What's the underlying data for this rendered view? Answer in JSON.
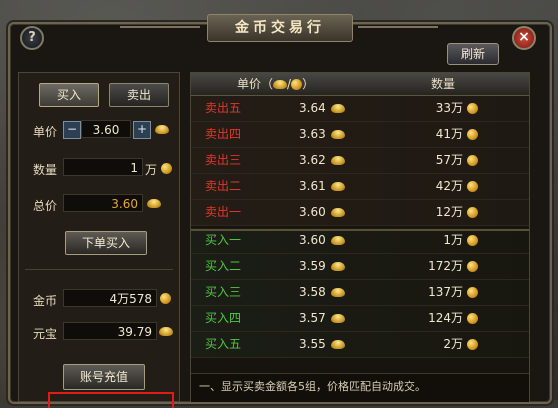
{
  "window": {
    "title": "金币交易行",
    "help_label": "?",
    "close_label": "×",
    "refresh_label": "刷新"
  },
  "tabs": [
    {
      "label": "买入",
      "active": true
    },
    {
      "label": "卖出",
      "active": false
    }
  ],
  "form": {
    "unit_price_label": "单价",
    "unit_price_value": "3.60",
    "minus_label": "−",
    "plus_label": "+",
    "quantity_label": "数量",
    "quantity_value": "1",
    "quantity_unit": "万",
    "total_label": "总价",
    "total_value": "3.60",
    "order_button": "下单买入"
  },
  "balance": {
    "gold_label": "金币",
    "gold_value": "4万578",
    "yuanbao_label": "元宝",
    "yuanbao_value": "39.79",
    "recharge_button": "账号充值"
  },
  "table": {
    "header_price": "单价（",
    "header_price_sep": "/",
    "header_price_end": "）",
    "header_qty": "数量",
    "sell_rows": [
      {
        "name": "卖出五",
        "price": "3.64",
        "qty": "33万"
      },
      {
        "name": "卖出四",
        "price": "3.63",
        "qty": "41万"
      },
      {
        "name": "卖出三",
        "price": "3.62",
        "qty": "57万"
      },
      {
        "name": "卖出二",
        "price": "3.61",
        "qty": "42万"
      },
      {
        "name": "卖出一",
        "price": "3.60",
        "qty": "12万"
      }
    ],
    "buy_rows": [
      {
        "name": "买入一",
        "price": "3.60",
        "qty": "1万"
      },
      {
        "name": "买入二",
        "price": "3.59",
        "qty": "172万"
      },
      {
        "name": "买入三",
        "price": "3.58",
        "qty": "137万"
      },
      {
        "name": "买入四",
        "price": "3.57",
        "qty": "124万"
      },
      {
        "name": "买入五",
        "price": "3.55",
        "qty": "2万"
      }
    ]
  },
  "notes": {
    "line1": "一、显示买卖金额各5组，价格匹配自动成交。"
  },
  "colors": {
    "sell": "#e2362c",
    "buy": "#4ec93a",
    "highlight": "#e21b14"
  }
}
